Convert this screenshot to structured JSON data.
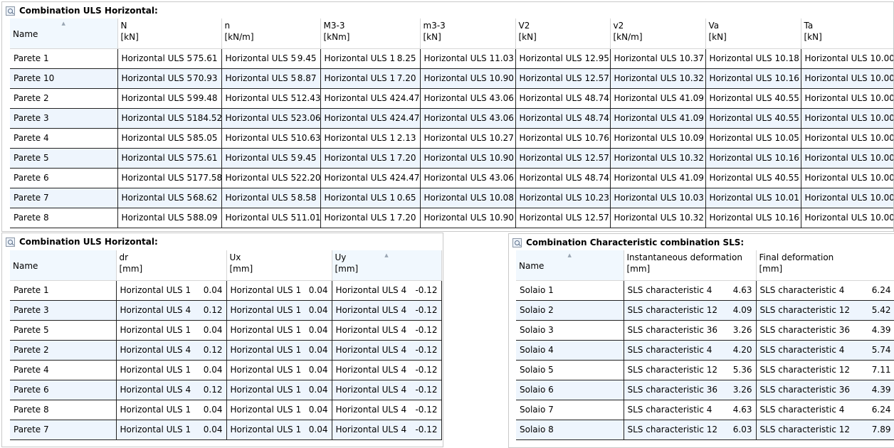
{
  "panel_top": {
    "title": "Combination ULS Horizontal:",
    "headers": [
      {
        "name": "Name",
        "unit": ""
      },
      {
        "name": "N",
        "unit": "[kN]"
      },
      {
        "name": "n",
        "unit": "[kN/m]"
      },
      {
        "name": "M3-3",
        "unit": "[kNm]"
      },
      {
        "name": "m3-3",
        "unit": "[kN]"
      },
      {
        "name": "V2",
        "unit": "[kN]"
      },
      {
        "name": "v2",
        "unit": "[kN/m]"
      },
      {
        "name": "Va",
        "unit": "[kN]"
      },
      {
        "name": "Ta",
        "unit": "[kN]"
      }
    ],
    "rows": [
      {
        "name": "Parete 1",
        "cells": [
          {
            "c": "Horizontal ULS 5",
            "v": "75.61"
          },
          {
            "c": "Horizontal ULS 5",
            "v": "9.45"
          },
          {
            "c": "Horizontal ULS 1",
            "v": "8.25"
          },
          {
            "c": "Horizontal ULS 1",
            "v": "1.03"
          },
          {
            "c": "Horizontal ULS 1",
            "v": "2.95"
          },
          {
            "c": "Horizontal ULS 1",
            "v": "0.37"
          },
          {
            "c": "Horizontal ULS 1",
            "v": "0.18"
          },
          {
            "c": "Horizontal ULS 1",
            "v": "0.00"
          }
        ]
      },
      {
        "name": "Parete 10",
        "cells": [
          {
            "c": "Horizontal ULS 5",
            "v": "70.93"
          },
          {
            "c": "Horizontal ULS 5",
            "v": "8.87"
          },
          {
            "c": "Horizontal ULS 1",
            "v": "7.20"
          },
          {
            "c": "Horizontal ULS 1",
            "v": "0.90"
          },
          {
            "c": "Horizontal ULS 1",
            "v": "2.57"
          },
          {
            "c": "Horizontal ULS 1",
            "v": "0.32"
          },
          {
            "c": "Horizontal ULS 1",
            "v": "0.16"
          },
          {
            "c": "Horizontal ULS 1",
            "v": "0.00"
          }
        ]
      },
      {
        "name": "Parete 2",
        "cells": [
          {
            "c": "Horizontal ULS 5",
            "v": "99.48"
          },
          {
            "c": "Horizontal ULS 5",
            "v": "12.43"
          },
          {
            "c": "Horizontal ULS 4",
            "v": "24.47"
          },
          {
            "c": "Horizontal ULS 4",
            "v": "3.06"
          },
          {
            "c": "Horizontal ULS 4",
            "v": "8.74"
          },
          {
            "c": "Horizontal ULS 4",
            "v": "1.09"
          },
          {
            "c": "Horizontal ULS 4",
            "v": "0.55"
          },
          {
            "c": "Horizontal ULS 1",
            "v": "0.00"
          }
        ]
      },
      {
        "name": "Parete 3",
        "cells": [
          {
            "c": "Horizontal ULS 5",
            "v": "184.52"
          },
          {
            "c": "Horizontal ULS 5",
            "v": "23.06"
          },
          {
            "c": "Horizontal ULS 4",
            "v": "24.47"
          },
          {
            "c": "Horizontal ULS 4",
            "v": "3.06"
          },
          {
            "c": "Horizontal ULS 4",
            "v": "8.74"
          },
          {
            "c": "Horizontal ULS 4",
            "v": "1.09"
          },
          {
            "c": "Horizontal ULS 4",
            "v": "0.55"
          },
          {
            "c": "Horizontal ULS 1",
            "v": "0.00"
          }
        ]
      },
      {
        "name": "Parete 4",
        "cells": [
          {
            "c": "Horizontal ULS 5",
            "v": "85.05"
          },
          {
            "c": "Horizontal ULS 5",
            "v": "10.63"
          },
          {
            "c": "Horizontal ULS 1",
            "v": "2.13"
          },
          {
            "c": "Horizontal ULS 1",
            "v": "0.27"
          },
          {
            "c": "Horizontal ULS 1",
            "v": "0.76"
          },
          {
            "c": "Horizontal ULS 1",
            "v": "0.09"
          },
          {
            "c": "Horizontal ULS 1",
            "v": "0.05"
          },
          {
            "c": "Horizontal ULS 1",
            "v": "0.00"
          }
        ]
      },
      {
        "name": "Parete 5",
        "cells": [
          {
            "c": "Horizontal ULS 5",
            "v": "75.61"
          },
          {
            "c": "Horizontal ULS 5",
            "v": "9.45"
          },
          {
            "c": "Horizontal ULS 1",
            "v": "7.20"
          },
          {
            "c": "Horizontal ULS 1",
            "v": "0.90"
          },
          {
            "c": "Horizontal ULS 1",
            "v": "2.57"
          },
          {
            "c": "Horizontal ULS 1",
            "v": "0.32"
          },
          {
            "c": "Horizontal ULS 1",
            "v": "0.16"
          },
          {
            "c": "Horizontal ULS 1",
            "v": "0.00"
          }
        ]
      },
      {
        "name": "Parete 6",
        "cells": [
          {
            "c": "Horizontal ULS 5",
            "v": "177.58"
          },
          {
            "c": "Horizontal ULS 5",
            "v": "22.20"
          },
          {
            "c": "Horizontal ULS 4",
            "v": "24.47"
          },
          {
            "c": "Horizontal ULS 4",
            "v": "3.06"
          },
          {
            "c": "Horizontal ULS 4",
            "v": "8.74"
          },
          {
            "c": "Horizontal ULS 4",
            "v": "1.09"
          },
          {
            "c": "Horizontal ULS 4",
            "v": "0.55"
          },
          {
            "c": "Horizontal ULS 1",
            "v": "0.00"
          }
        ]
      },
      {
        "name": "Parete 7",
        "cells": [
          {
            "c": "Horizontal ULS 5",
            "v": "68.62"
          },
          {
            "c": "Horizontal ULS 5",
            "v": "8.58"
          },
          {
            "c": "Horizontal ULS 1",
            "v": "0.65"
          },
          {
            "c": "Horizontal ULS 1",
            "v": "0.08"
          },
          {
            "c": "Horizontal ULS 1",
            "v": "0.23"
          },
          {
            "c": "Horizontal ULS 1",
            "v": "0.03"
          },
          {
            "c": "Horizontal ULS 1",
            "v": "0.01"
          },
          {
            "c": "Horizontal ULS 1",
            "v": "0.00"
          }
        ]
      },
      {
        "name": "Parete 8",
        "cells": [
          {
            "c": "Horizontal ULS 5",
            "v": "88.09"
          },
          {
            "c": "Horizontal ULS 5",
            "v": "11.01"
          },
          {
            "c": "Horizontal ULS 1",
            "v": "7.20"
          },
          {
            "c": "Horizontal ULS 1",
            "v": "0.90"
          },
          {
            "c": "Horizontal ULS 1",
            "v": "2.57"
          },
          {
            "c": "Horizontal ULS 1",
            "v": "0.32"
          },
          {
            "c": "Horizontal ULS 1",
            "v": "0.16"
          },
          {
            "c": "Horizontal ULS 1",
            "v": "0.00"
          }
        ]
      }
    ]
  },
  "panel_left": {
    "title": "Combination ULS Horizontal:",
    "headers": [
      {
        "name": "Name",
        "unit": ""
      },
      {
        "name": "dr",
        "unit": "[mm]"
      },
      {
        "name": "Ux",
        "unit": "[mm]"
      },
      {
        "name": "Uy",
        "unit": "[mm]"
      }
    ],
    "rows": [
      {
        "name": "Parete 1",
        "cells": [
          {
            "c": "Horizontal ULS 1",
            "v": "0.04"
          },
          {
            "c": "Horizontal ULS 1",
            "v": "0.04"
          },
          {
            "c": "Horizontal ULS 4",
            "v": "-0.12"
          }
        ]
      },
      {
        "name": "Parete 3",
        "cells": [
          {
            "c": "Horizontal ULS 4",
            "v": "0.12"
          },
          {
            "c": "Horizontal ULS 1",
            "v": "0.04"
          },
          {
            "c": "Horizontal ULS 4",
            "v": "-0.12"
          }
        ]
      },
      {
        "name": "Parete 5",
        "cells": [
          {
            "c": "Horizontal ULS 1",
            "v": "0.04"
          },
          {
            "c": "Horizontal ULS 1",
            "v": "0.04"
          },
          {
            "c": "Horizontal ULS 4",
            "v": "-0.12"
          }
        ]
      },
      {
        "name": "Parete 2",
        "cells": [
          {
            "c": "Horizontal ULS 4",
            "v": "0.12"
          },
          {
            "c": "Horizontal ULS 1",
            "v": "0.04"
          },
          {
            "c": "Horizontal ULS 4",
            "v": "-0.12"
          }
        ]
      },
      {
        "name": "Parete 4",
        "cells": [
          {
            "c": "Horizontal ULS 1",
            "v": "0.04"
          },
          {
            "c": "Horizontal ULS 1",
            "v": "0.04"
          },
          {
            "c": "Horizontal ULS 4",
            "v": "-0.12"
          }
        ]
      },
      {
        "name": "Parete 6",
        "cells": [
          {
            "c": "Horizontal ULS 4",
            "v": "0.12"
          },
          {
            "c": "Horizontal ULS 1",
            "v": "0.04"
          },
          {
            "c": "Horizontal ULS 4",
            "v": "-0.12"
          }
        ]
      },
      {
        "name": "Parete 8",
        "cells": [
          {
            "c": "Horizontal ULS 1",
            "v": "0.04"
          },
          {
            "c": "Horizontal ULS 1",
            "v": "0.04"
          },
          {
            "c": "Horizontal ULS 4",
            "v": "-0.12"
          }
        ]
      },
      {
        "name": "Parete 7",
        "cells": [
          {
            "c": "Horizontal ULS 1",
            "v": "0.04"
          },
          {
            "c": "Horizontal ULS 1",
            "v": "0.04"
          },
          {
            "c": "Horizontal ULS 4",
            "v": "-0.12"
          }
        ]
      }
    ]
  },
  "panel_right": {
    "title": "Combination Characteristic combination SLS:",
    "headers": [
      {
        "name": "Name",
        "unit": ""
      },
      {
        "name": "Instantaneous deformation",
        "unit": "[mm]"
      },
      {
        "name": "Final deformation",
        "unit": "[mm]"
      }
    ],
    "rows": [
      {
        "name": "Solaio 1",
        "cells": [
          {
            "c": "SLS characteristic 4",
            "v": "4.63"
          },
          {
            "c": "SLS characteristic 4",
            "v": "6.24"
          }
        ]
      },
      {
        "name": "Solaio 2",
        "cells": [
          {
            "c": "SLS characteristic 12",
            "v": "4.09"
          },
          {
            "c": "SLS characteristic 12",
            "v": "5.42"
          }
        ]
      },
      {
        "name": "Solaio 3",
        "cells": [
          {
            "c": "SLS characteristic 36",
            "v": "3.26"
          },
          {
            "c": "SLS characteristic 36",
            "v": "4.39"
          }
        ]
      },
      {
        "name": "Solaio 4",
        "cells": [
          {
            "c": "SLS characteristic 4",
            "v": "4.20"
          },
          {
            "c": "SLS characteristic 4",
            "v": "5.74"
          }
        ]
      },
      {
        "name": "Solaio 5",
        "cells": [
          {
            "c": "SLS characteristic 12",
            "v": "5.36"
          },
          {
            "c": "SLS characteristic 12",
            "v": "7.11"
          }
        ]
      },
      {
        "name": "Solaio 6",
        "cells": [
          {
            "c": "SLS characteristic 36",
            "v": "3.26"
          },
          {
            "c": "SLS characteristic 36",
            "v": "4.39"
          }
        ]
      },
      {
        "name": "Solaio 7",
        "cells": [
          {
            "c": "SLS characteristic 4",
            "v": "4.63"
          },
          {
            "c": "SLS characteristic 4",
            "v": "6.24"
          }
        ]
      },
      {
        "name": "Solaio 8",
        "cells": [
          {
            "c": "SLS characteristic 12",
            "v": "6.03"
          },
          {
            "c": "SLS characteristic 12",
            "v": "7.89"
          }
        ]
      }
    ]
  },
  "colors": {
    "header_highlight": "#f1f8fe",
    "row_alternate": "#eef5fd",
    "grid_line": "#222222"
  }
}
